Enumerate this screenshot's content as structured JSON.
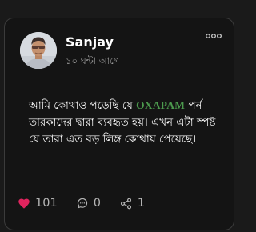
{
  "post": {
    "author": "Sanjay",
    "timestamp": "১০ ঘন্টা আগে",
    "text_before": "আমি কোথাও পড়েছি যে ",
    "brand": "OXAPAM",
    "text_after": " পর্ন তারকাদের দ্বারা ব্যবহৃত হয়। এখন এটা স্পষ্ট যে তারা এত বড় লিঙ্গ কোথায় পেয়েছে।",
    "brand_color": "#4c9a4e"
  },
  "actions": {
    "likes": "101",
    "comments": "0",
    "shares": "1"
  },
  "icons": {
    "more": "more-dots-icon",
    "like": "heart-icon",
    "comment": "comment-bubble-icon",
    "share": "share-icon"
  },
  "colors": {
    "background": "#1a1a1a",
    "card": "#141414",
    "heart": "#e0245e",
    "muted": "#9b9b9b"
  }
}
